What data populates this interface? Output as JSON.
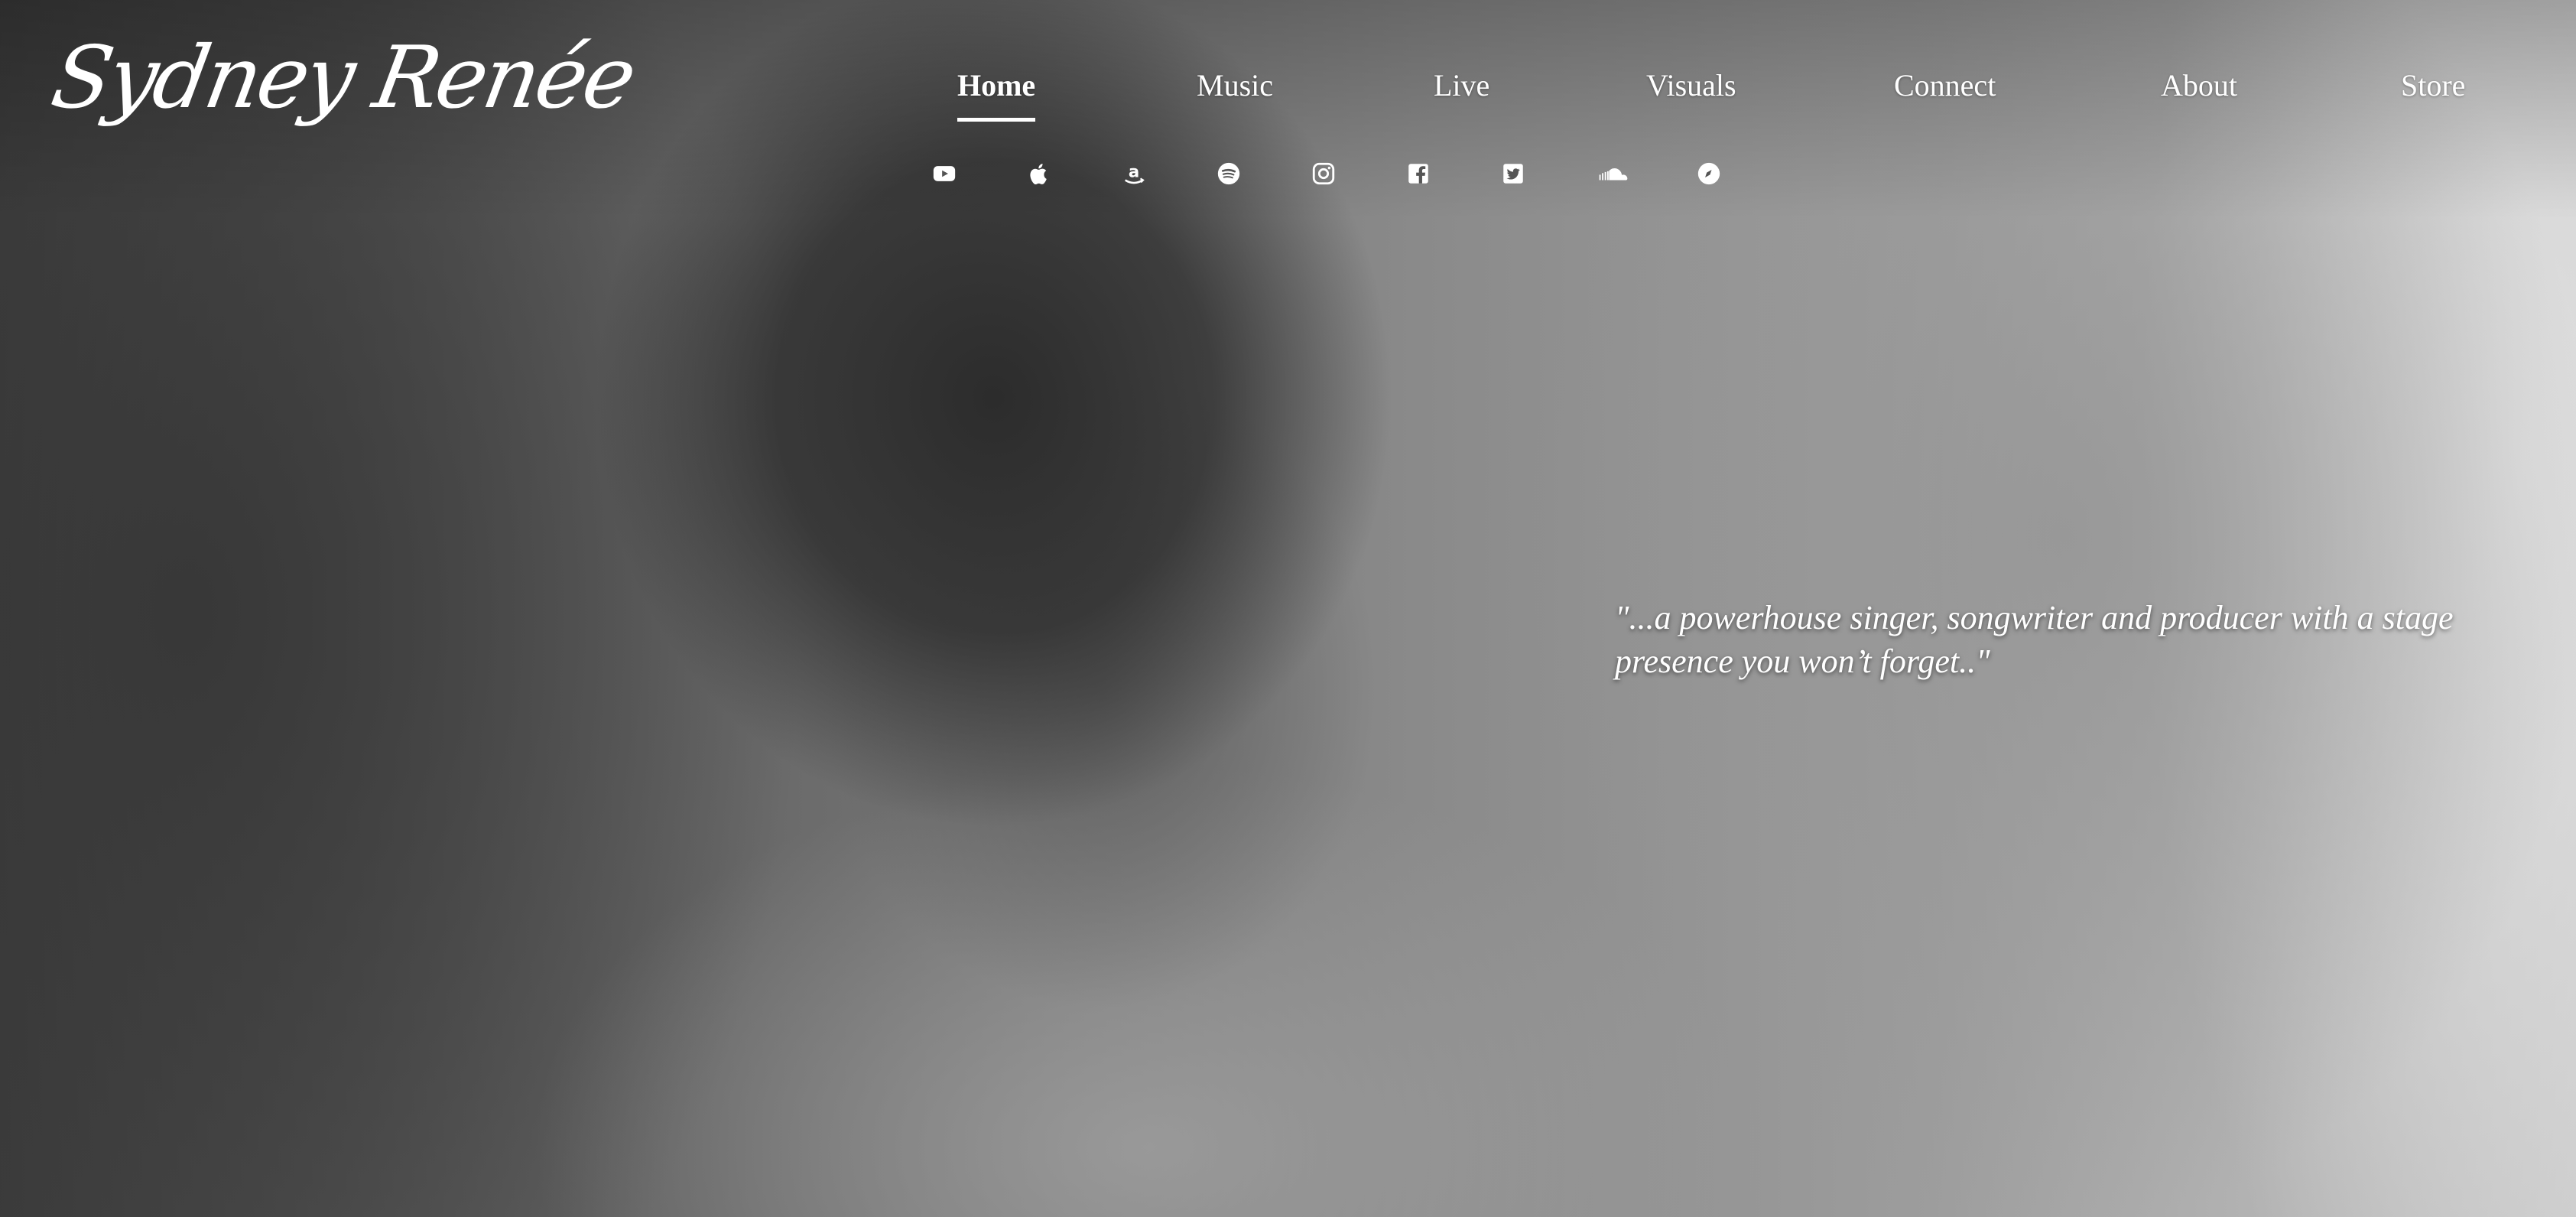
{
  "logo": {
    "text": "Sydney Renée"
  },
  "nav": {
    "items": [
      {
        "label": "Home",
        "active": true
      },
      {
        "label": "Music",
        "active": false
      },
      {
        "label": "Live",
        "active": false
      },
      {
        "label": "Visuals",
        "active": false
      },
      {
        "label": "Connect",
        "active": false
      },
      {
        "label": "About",
        "active": false
      },
      {
        "label": "Store",
        "active": false
      }
    ]
  },
  "social": {
    "icons": [
      "youtube-icon",
      "apple-icon",
      "amazon-icon",
      "spotify-icon",
      "instagram-icon",
      "facebook-icon",
      "twitter-icon",
      "soundcloud-icon",
      "bandsintown-icon"
    ]
  },
  "hero": {
    "quote": "\"...a powerhouse singer, songwriter and producer with a stage presence you won’t forget..\""
  },
  "colors": {
    "text": "#ffffff",
    "background": "#7a7a7a"
  }
}
